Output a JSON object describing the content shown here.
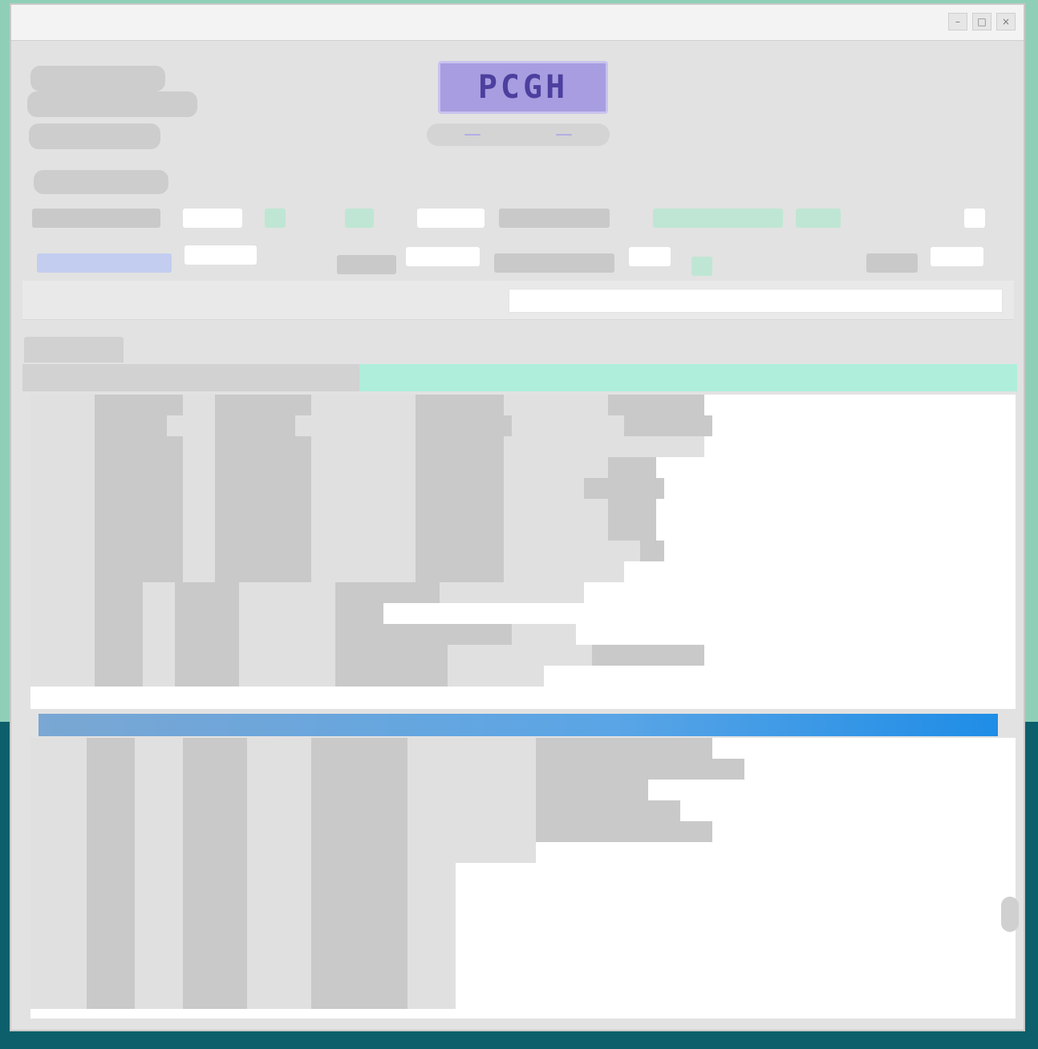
{
  "window": {
    "title": "",
    "controls": [
      "–",
      "□",
      "×"
    ]
  },
  "header": {
    "logo_text": "PCGH",
    "logo_links": [
      "",
      ""
    ],
    "left_chips": [
      "",
      "",
      "",
      ""
    ]
  },
  "toolbar_row1": [
    "",
    "",
    "",
    "",
    "",
    "",
    "",
    "",
    ""
  ],
  "toolbar_row2": [
    "",
    "",
    "",
    "",
    "",
    "",
    "",
    "",
    "",
    ""
  ],
  "command": {
    "prompt_text": "",
    "input_value": ""
  },
  "panel_tab": "",
  "status_label": "",
  "top_pane_rows": [
    [
      "",
      "",
      "",
      "",
      "",
      "",
      "",
      ""
    ],
    [
      "",
      "",
      "",
      "",
      "",
      "",
      "",
      ""
    ],
    [
      "",
      "",
      "",
      "",
      "",
      "",
      "",
      ""
    ],
    [
      "",
      "",
      "",
      "",
      "",
      "",
      "",
      ""
    ],
    [
      "",
      "",
      "",
      "",
      "",
      "",
      "",
      ""
    ],
    [
      "",
      "",
      "",
      "",
      "",
      "",
      "",
      ""
    ],
    [
      "",
      "",
      "",
      "",
      "",
      "",
      "",
      ""
    ],
    [
      "",
      "",
      "",
      "",
      "",
      "",
      "",
      ""
    ],
    [
      "",
      "",
      "",
      "",
      "",
      "",
      "",
      ""
    ],
    [
      "",
      "",
      "",
      "",
      "",
      "",
      "",
      ""
    ],
    [
      "",
      "",
      "",
      "",
      "",
      "",
      "",
      ""
    ],
    [
      "",
      "",
      "",
      "",
      "",
      "",
      "",
      ""
    ],
    [
      "",
      "",
      "",
      "",
      "",
      "",
      "",
      ""
    ],
    [
      "",
      "",
      "",
      "",
      "",
      "",
      "",
      ""
    ]
  ],
  "bottom_pane_rows": [
    [
      "",
      "",
      "",
      "",
      "",
      "",
      "",
      ""
    ],
    [
      "",
      "",
      "",
      "",
      "",
      "",
      "",
      ""
    ],
    [
      "",
      "",
      "",
      "",
      "",
      "",
      "",
      ""
    ],
    [
      "",
      "",
      "",
      "",
      "",
      "",
      "",
      ""
    ],
    [
      "",
      "",
      "",
      "",
      "",
      "",
      "",
      ""
    ],
    [
      "",
      "",
      "",
      "",
      "",
      "",
      "",
      ""
    ],
    [
      "",
      "",
      "",
      "",
      "",
      "",
      "",
      ""
    ],
    [
      "",
      "",
      "",
      "",
      "",
      "",
      "",
      ""
    ],
    [
      "",
      "",
      "",
      "",
      "",
      "",
      "",
      ""
    ],
    [
      "",
      "",
      "",
      "",
      "",
      "",
      "",
      ""
    ],
    [
      "",
      "",
      "",
      "",
      "",
      "",
      "",
      ""
    ],
    [
      "",
      "",
      "",
      "",
      "",
      "",
      "",
      ""
    ],
    [
      "",
      "",
      "",
      "",
      "",
      "",
      "",
      ""
    ]
  ],
  "colors": {
    "desktop": "#0c5f6b",
    "accent_mint": "#aeeedb",
    "splitter_blue": "#1f8de6",
    "logo_purple": "#a79de0"
  }
}
